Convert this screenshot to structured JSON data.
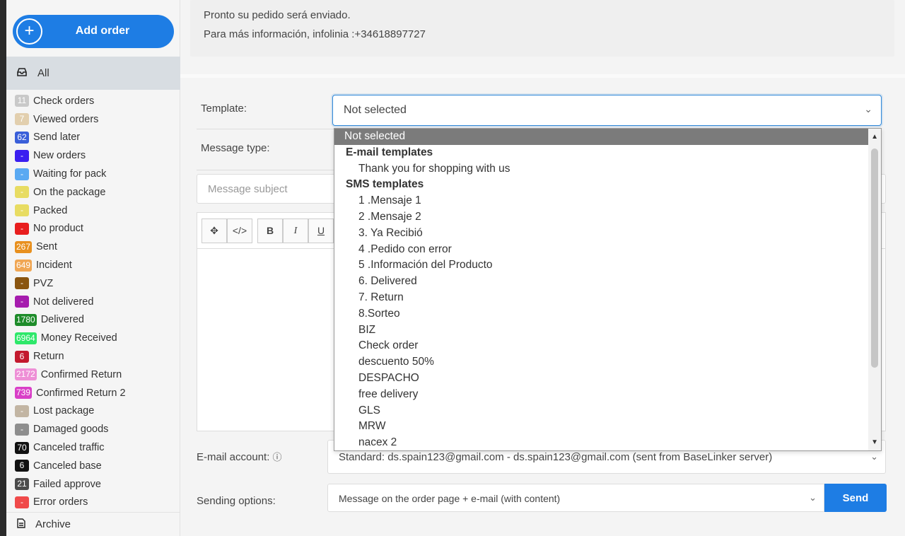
{
  "sidebar": {
    "add_order_label": "Add order",
    "all_label": "All",
    "archive_label": "Archive",
    "statuses": [
      {
        "count": "11",
        "label": "Check orders",
        "color": "#c9c9c9"
      },
      {
        "count": "7",
        "label": "Viewed orders",
        "color": "#e2cfae"
      },
      {
        "count": "62",
        "label": "Send later",
        "color": "#3a5fd9"
      },
      {
        "count": "-",
        "label": "New orders",
        "color": "#3b1ff0"
      },
      {
        "count": "-",
        "label": "Waiting for pack",
        "color": "#5aa9f2"
      },
      {
        "count": "-",
        "label": "On the package",
        "color": "#e8dc62"
      },
      {
        "count": "-",
        "label": "Packed",
        "color": "#e8dc62"
      },
      {
        "count": "-",
        "label": "No product",
        "color": "#e81e1e"
      },
      {
        "count": "267",
        "label": "Sent",
        "color": "#e8901e"
      },
      {
        "count": "649",
        "label": "Incident",
        "color": "#f0a653"
      },
      {
        "count": "-",
        "label": "PVZ",
        "color": "#8a5510"
      },
      {
        "count": "-",
        "label": "Not delivered",
        "color": "#a61dae"
      },
      {
        "count": "1780",
        "label": "Delivered",
        "color": "#1e8c2a"
      },
      {
        "count": "6964",
        "label": "Money Received",
        "color": "#2ee86a"
      },
      {
        "count": "6",
        "label": "Return",
        "color": "#c31a2e"
      },
      {
        "count": "2172",
        "label": "Confirmed Return",
        "color": "#ee8fd6"
      },
      {
        "count": "739",
        "label": "Confirmed Return 2",
        "color": "#d93fc7"
      },
      {
        "count": "-",
        "label": "Lost package",
        "color": "#c2b5a3"
      },
      {
        "count": "-",
        "label": "Damaged goods",
        "color": "#8e8e8e"
      },
      {
        "count": "70",
        "label": "Canceled traffic",
        "color": "#111111"
      },
      {
        "count": "6",
        "label": "Canceled base",
        "color": "#111111"
      },
      {
        "count": "21",
        "label": "Failed approve",
        "color": "#4b4b4b"
      },
      {
        "count": "-",
        "label": "Error orders",
        "color": "#f04a4a"
      }
    ]
  },
  "message_preview": {
    "line1": "Pronto su pedido será enviado.",
    "line2": "Para más información, infolinia :+34618897727"
  },
  "form": {
    "template_label": "Template:",
    "template_value": "Not selected",
    "message_type_label": "Message type:",
    "subject_placeholder": "Message subject",
    "email_account_label": "E-mail account:",
    "email_account_value": "Standard: ds.spain123@gmail.com - ds.spain123@gmail.com (sent from BaseLinker server)",
    "sending_options_label": "Sending options:",
    "sending_options_value": "Message on the order page + e-mail (with content)",
    "send_button": "Send"
  },
  "dropdown": {
    "selected": "Not selected",
    "email_group": "E-mail templates",
    "email_options": [
      "Thank you for shopping with us"
    ],
    "sms_group": "SMS templates",
    "sms_options": [
      "1 .Mensaje 1",
      "2 .Mensaje 2",
      "3. Ya Recibió",
      "4 .Pedido con error",
      "5 .Información del Producto",
      "6. Delivered",
      "7. Return",
      "8.Sorteo",
      "BIZ",
      "Check order",
      "descuento 50%",
      "DESPACHO",
      "free delivery",
      "GLS",
      "MRW",
      "nacex 2"
    ]
  },
  "icons": {
    "plus": "plus-circle-icon",
    "inbox": "inbox-icon",
    "archive": "document-icon",
    "move": "move-icon",
    "code": "code-icon",
    "bold": "bold-icon",
    "italic": "italic-icon",
    "underline": "underline-icon",
    "help": "question-circle-icon"
  }
}
